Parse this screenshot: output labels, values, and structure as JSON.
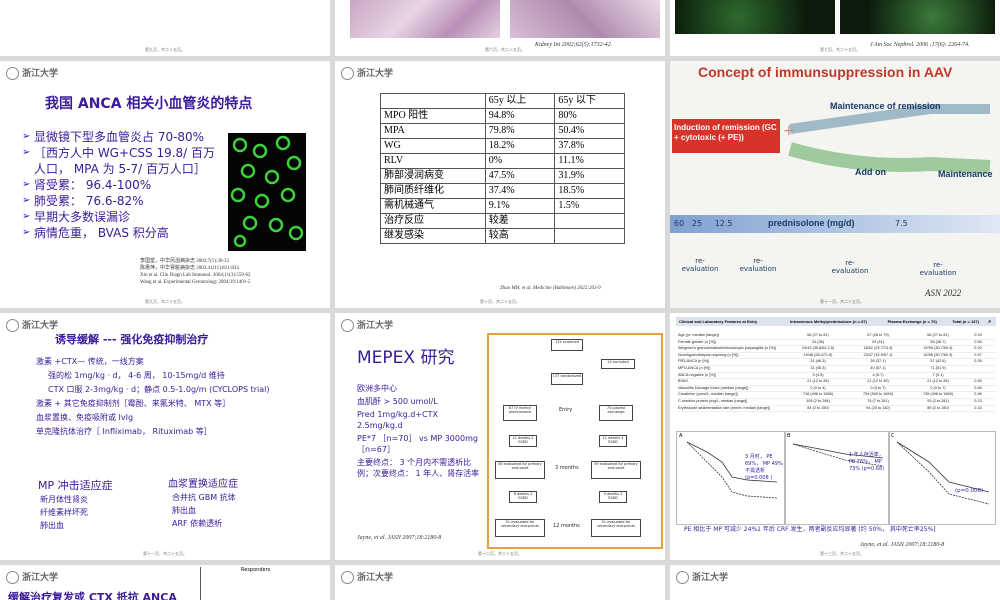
{
  "row0": {
    "s1_page": "第九页，共二十五页。",
    "s2_ref": "Kidney Int 2002;62(5):1732-42.",
    "s2_page": "第六页，共二十五页。",
    "s3_ref": "J Am Soc Nephrol. 2006 ;17(6): 2264-74.",
    "s3_page": "第七页，共二十五页。"
  },
  "logo": "浙江大学",
  "s4": {
    "title": "我国 ANCA 相关小血管炎的特点",
    "bullets": [
      "显微镜下型多血管炎占 70-80%",
      "［西方人中 WG+CSS 19.8/ 百万人口， MPA 为 5-7/ 百万人口］",
      "肾受累： 96.4-100%",
      "肺受累： 76.6-82%",
      "早期大多数误漏诊",
      "病情危重， BVAS 积分高"
    ],
    "refs": [
      "李国堂，中华风湿病杂志 2003;7(1):30-33",
      "陈惠萍，中华肾脏病杂志 2003;41(11):831-834",
      "Xin et al. Clin Diagn Lab Immunol. 2004;11(3):559-62",
      "Wang et al. Experimental Gerontology 2004;39:1401-5"
    ],
    "page": "第九页，共二十五页。"
  },
  "s5": {
    "header": [
      "",
      "65y 以上",
      "65y 以下"
    ],
    "rows": [
      [
        "MPO 阳性",
        "94.8%",
        "80%"
      ],
      [
        "MPA",
        "79.8%",
        "50.4%"
      ],
      [
        "WG",
        "18.2%",
        "37.8%"
      ],
      [
        "RLV",
        "0%",
        "11.1%"
      ],
      [
        "肺部浸润病变",
        "47.5%",
        "31.9%"
      ],
      [
        "肺间质纤维化",
        "37.4%",
        "18.5%"
      ],
      [
        "需机械通气",
        "9.1%",
        "1.5%"
      ],
      [
        "治疗反应",
        "较差",
        ""
      ],
      [
        "继发感染",
        "较高",
        ""
      ]
    ],
    "ref": "Zhao MH, et al. Medicine (Baltimore) 2022;203-9",
    "page": "第十页，共二十五页。"
  },
  "s6": {
    "title": "Concept of immunsuppression in AAV",
    "induction": "Induction of remission (GC + cytotoxic (+ PE))",
    "maintenance_top": "Maintenance of remission",
    "addon": "Add on",
    "maintenance": "Maintenance",
    "pred_nums": "60   25     12.5",
    "pred_label": "prednisolone (mg/d)",
    "pred_end": "7.5",
    "reeval": [
      "re-evaluation",
      "re-evaluation",
      "re-evaluation",
      "re-evaluation"
    ],
    "ref": "ASN 2022",
    "page": "第十一页，共二十五页。"
  },
  "s7": {
    "title": "诱导缓解 --- 强化免疫抑制治疗",
    "lines": [
      "激素 +CTX— 传统，一线方案",
      "强的松 1mg/kg · d， 4-6 周， 10-15mg/d 维持",
      "CTX 口服 2-3mg/kg · d；静点 0.5-1.0g/m (CYCLOPS trial)",
      "激素 + 其它免疫抑制剂［霉酚、来氟米特、 MTX 等］",
      "血浆置换、免疫吸附或 IvIg",
      "单克隆抗体治疗［ Infliximab， Rituximab 等］"
    ],
    "mp_title": "MP 冲击适应症",
    "mp_items": [
      "新月体性肾炎",
      "纤维素样坏死",
      "肺出血"
    ],
    "pe_title": "血浆置换适应症",
    "pe_items": [
      "合并抗 GBM 抗体",
      "肺出血",
      "ARF 依赖透析"
    ],
    "page": "第十一页，共二十五页。"
  },
  "s8": {
    "title": "MEPEX 研究",
    "bullets": [
      "欧洲多中心",
      "血肌酐 > 500 umol/L",
      "Pred 1mg/kg.d+CTX 2.5mg/kg.d",
      "PE*7 ［n=70］ vs MP 3000mg ［n=67］",
      "主要终点： 3 个月内不需透析比例；次要终点： 1 年人、肾存活率"
    ],
    "flow": [
      "151 screened",
      "14 excluded",
      "137 randomized",
      "67 IV methyl prednisolone",
      "Entry",
      "70 plasma exchange",
      "11 deaths 2 ESRD",
      "11 deaths 4 ESRD",
      "56 evaluated for primary end-point",
      "3 months",
      "59 evaluated for primary end-point",
      "8 deaths 2 ESRD",
      "5 deaths 2 ESRD",
      "51 evaluated for secondary end-points",
      "12 months",
      "51 evaluated for secondary end-points"
    ],
    "ref": "Jayne, et al. JASN 2007;18:2180-8",
    "page": "第十二页，共二十五页。"
  },
  "s9": {
    "header": [
      "Clinical and Laboratory Features at Entry",
      "Intravenous Methylprednisolone (n = 67)",
      "Plasma Exchange (n = 70)",
      "Total (n = 137)",
      "P"
    ],
    "rows": [
      [
        "Age (yr; median [range])",
        "66 (27 to 81)",
        "67 (28 to 79)",
        "66 (27 to 81)",
        "0.93"
      ],
      [
        "Female gender (n [%])",
        "24 (36)",
        "29 (41)",
        "53 (38.7)",
        "0.50"
      ],
      [
        "Wegener's granulomatosis/microscopic polyangiitis (n [%])",
        "24/43 (35.8/64.2 8)",
        "18/52 (25.7/74.3)",
        "42/95 (30.7/69.3)",
        "0.20"
      ],
      [
        "Nonoliguric/dialysis requiring (n [%])",
        "19/48 (28.4/71.6)",
        "23/47 (32.9/67.1)",
        "42/95 (30.7/69.3)",
        "0.57"
      ],
      [
        "PR3-ANCA (n [%])",
        "31 (46.3)",
        "26 (37.1)",
        "57 (42.6)",
        "0.35"
      ],
      [
        "MPO-ANCA (n [%])",
        "31 (46.3)",
        "40 (57.1)",
        "71 (51.9)",
        ""
      ],
      [
        "ANCA negative (n [%])",
        "3 (4.5)",
        "4 (5.7)",
        "7 (5.1)",
        ""
      ],
      [
        "BVAS",
        "21 (12 to 45)",
        "21 (12 to 39)",
        "21 (12 to 45)",
        "0.69"
      ],
      [
        "Vasculitis Damage Index (median [range])",
        "0 (0 to 4)",
        "0 (0 to 7)",
        "0 (0 to 7)",
        "0.66"
      ],
      [
        "Creatinine (μmol/L; median [range])",
        "716 (498 to 1566)",
        "754 (500 to 1669)",
        "735 (498 to 1669)",
        "0.96"
      ],
      [
        "C-reactive protein (mg/L; median [range])",
        "109 (2 to 264)",
        "76 (7 to 281)",
        "93 (2 to 281)",
        "0.23"
      ],
      [
        "Erythrocyte sedimentation rate (mm/h; median [range])",
        "84 (2 to 150)",
        "94 (20 to 140)",
        "89 (2 to 150)",
        "0.34"
      ]
    ],
    "panels": [
      "A",
      "B",
      "C"
    ],
    "noteA": "3 月时， PE 69%， MP 49% 不需透析 (p=0.008 )",
    "noteB": "1 年人存活率， PE 76%， MP 73% (p=0.68)",
    "noteC": "(p=0.008)",
    "summary": "PE 相比于 MP 可减少 24%1 年后 CRF 发生，两者副反应均显著 [约 50%， 其中死亡率25%]",
    "ref": "Jayne, et al. JASN 2007;18:2180-8",
    "page": "第十三页，共二十五页。"
  },
  "s10": {
    "title": "缓解治疗复发或 CTX 抵抗 ANCA",
    "chart_title": "Responders"
  }
}
